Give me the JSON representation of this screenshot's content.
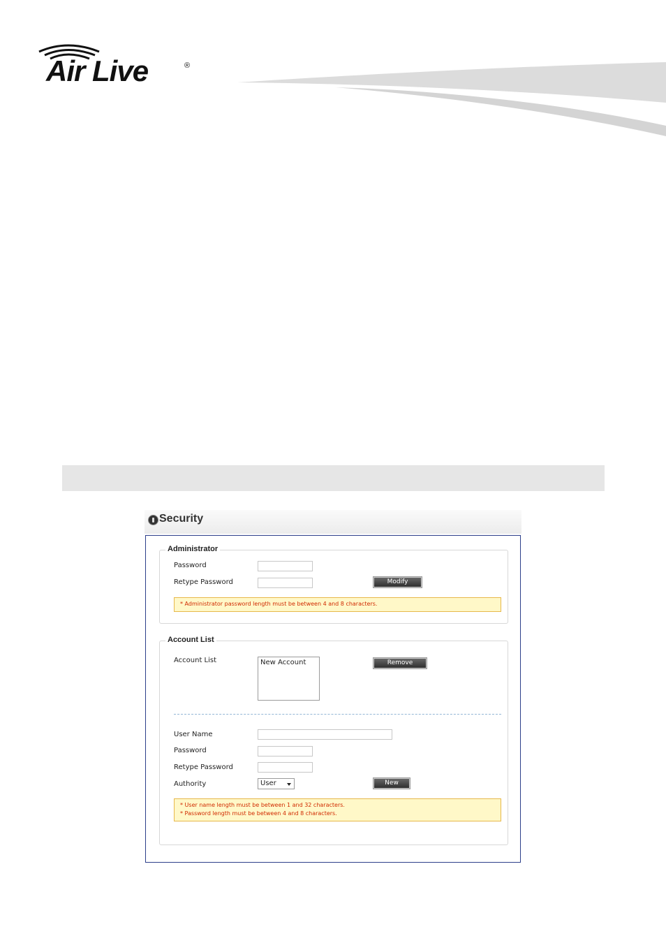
{
  "brand": {
    "logo_text": "Air Live",
    "reg_mark": "®"
  },
  "security": {
    "title": "Security",
    "administrator": {
      "legend": "Administrator",
      "password_label": "Password",
      "password_value": "",
      "retype_label": "Retype Password",
      "retype_value": "",
      "modify_button": "Modify",
      "note": "* Administrator password length must be between 4 and 8 characters."
    },
    "account_list": {
      "legend": "Account List",
      "list_label": "Account List",
      "items": [
        "New Account"
      ],
      "remove_button": "Remove",
      "username_label": "User Name",
      "username_value": "",
      "password_label": "Password",
      "password_value": "",
      "retype_label": "Retype Password",
      "retype_value": "",
      "authority_label": "Authority",
      "authority_selected": "User",
      "new_button": "New",
      "notes": [
        "* User name length must be between 1 and 32 characters.",
        "* Password length must be between 4 and 8 characters."
      ]
    }
  },
  "colors": {
    "panel_border": "#2c3e8a",
    "note_background": "#fff8c8",
    "note_text": "#d02a00",
    "header_bar": "#e6e6e6"
  }
}
